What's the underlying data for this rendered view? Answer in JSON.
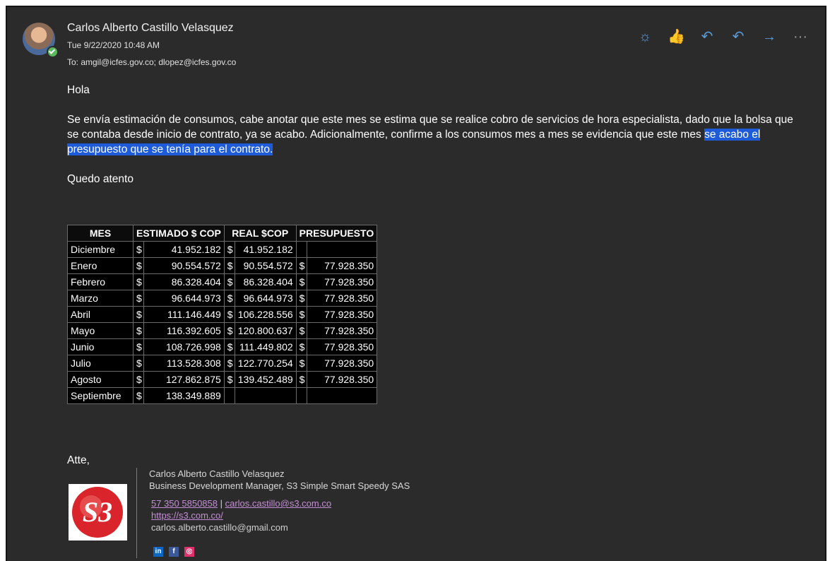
{
  "email": {
    "sender_name": "Carlos Alberto Castillo Velasquez",
    "date": "Tue 9/22/2020 10:48 AM",
    "to": "To:  amgil@icfes.gov.co;  dlopez@icfes.gov.co"
  },
  "actions": [
    {
      "name": "brightness-icon",
      "glyph": "☼"
    },
    {
      "name": "like-icon",
      "glyph": "👍"
    },
    {
      "name": "reply-icon",
      "glyph": "↶"
    },
    {
      "name": "reply-all-icon",
      "glyph": "↶"
    },
    {
      "name": "forward-icon",
      "glyph": "→"
    },
    {
      "name": "more-icon",
      "glyph": "···"
    }
  ],
  "body": {
    "greeting": "Hola",
    "paragraph_1": "Se envía estimación de consumos, cabe anotar que este mes se estima que se realice cobro de servicios de hora especialista, dado que la bolsa que se contaba desde inicio de contrato, ya se acabo.  Adicionalmente, confirme a los consumos mes a mes se evidencia que este mes ",
    "paragraph_1_highlight": "se acabo el presupuesto que se tenía para el contrato.",
    "closing": "Quedo atento"
  },
  "table": {
    "headers": [
      "MES",
      "ESTIMADO $ COP",
      "REAL  $COP",
      "PRESUPUESTO"
    ],
    "rows": [
      {
        "mes": "Diciembre",
        "estimado": "41.952.182",
        "real": "41.952.182",
        "presupuesto": ""
      },
      {
        "mes": "Enero",
        "estimado": "90.554.572",
        "real": "90.554.572",
        "presupuesto": "77.928.350"
      },
      {
        "mes": "Febrero",
        "estimado": "86.328.404",
        "real": "86.328.404",
        "presupuesto": "77.928.350"
      },
      {
        "mes": "Marzo",
        "estimado": "96.644.973",
        "real": "96.644.973",
        "presupuesto": "77.928.350"
      },
      {
        "mes": "Abril",
        "estimado": "111.146.449",
        "real": "106.228.556",
        "presupuesto": "77.928.350"
      },
      {
        "mes": "Mayo",
        "estimado": "116.392.605",
        "real": "120.800.637",
        "presupuesto": "77.928.350"
      },
      {
        "mes": "Junio",
        "estimado": "108.726.998",
        "real": "111.449.802",
        "presupuesto": "77.928.350"
      },
      {
        "mes": "Julio",
        "estimado": "113.528.308",
        "real": "122.770.254",
        "presupuesto": "77.928.350"
      },
      {
        "mes": "Agosto",
        "estimado": "127.862.875",
        "real": "139.452.489",
        "presupuesto": "77.928.350"
      },
      {
        "mes": "Septiembre",
        "estimado": "138.349.889",
        "real": "",
        "presupuesto": ""
      }
    ]
  },
  "signature": {
    "atte": "Atte,",
    "name": "Carlos Alberto Castillo Velasquez",
    "title": "Business Development Manager, S3 Simple Smart Speedy SAS",
    "phone": "57 350 5850858",
    "separator": " | ",
    "email": "carlos.castillo@s3.com.co",
    "website": "https://s3.com.co/",
    "personal_email": "carlos.alberto.castillo@gmail.com",
    "logo_text": "S3",
    "social": [
      {
        "name": "linkedin-icon",
        "label": "in",
        "color": "#0a66c2"
      },
      {
        "name": "facebook-icon",
        "label": "f",
        "color": "#3b5998"
      },
      {
        "name": "instagram-icon",
        "label": "◎",
        "color": "#e1306c"
      }
    ]
  },
  "colors": {
    "accent": "#5b9bd5",
    "highlight": "#1d5bd8",
    "link": "#c48ed6",
    "background": "#2b2b2b"
  }
}
